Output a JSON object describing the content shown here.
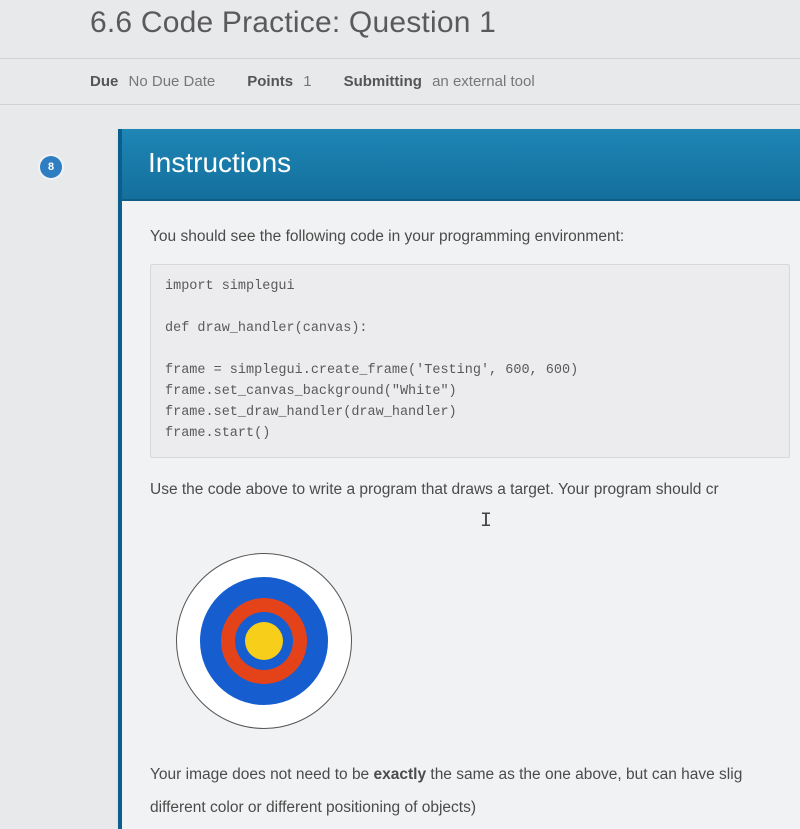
{
  "title": "6.6 Code Practice: Question 1",
  "meta": {
    "due_label": "Due",
    "due_value": "No Due Date",
    "points_label": "Points",
    "points_value": "1",
    "submitting_label": "Submitting",
    "submitting_value": "an external tool"
  },
  "badge": "8",
  "panel": {
    "header": "Instructions",
    "intro": "You should see the following code in your programming environment:",
    "code": "import simplegui\n\ndef draw_handler(canvas):\n\nframe = simplegui.create_frame('Testing', 600, 600)\nframe.set_canvas_background(\"White\")\nframe.set_draw_handler(draw_handler)\nframe.start()",
    "para2": "Use the code above to write a program that draws a target. Your program should cr",
    "cursor": "I",
    "closing_pre": "Your image does not need to be ",
    "closing_strong": "exactly",
    "closing_post": " the same as the one above, but can have slig",
    "closing_line2": "different color or different positioning of objects)"
  },
  "target_colors": {
    "outer_border": "#555",
    "outer_fill": "#ffffff",
    "blue": "#165ed0",
    "red": "#e4431a",
    "yellow": "#f7cf1a"
  }
}
